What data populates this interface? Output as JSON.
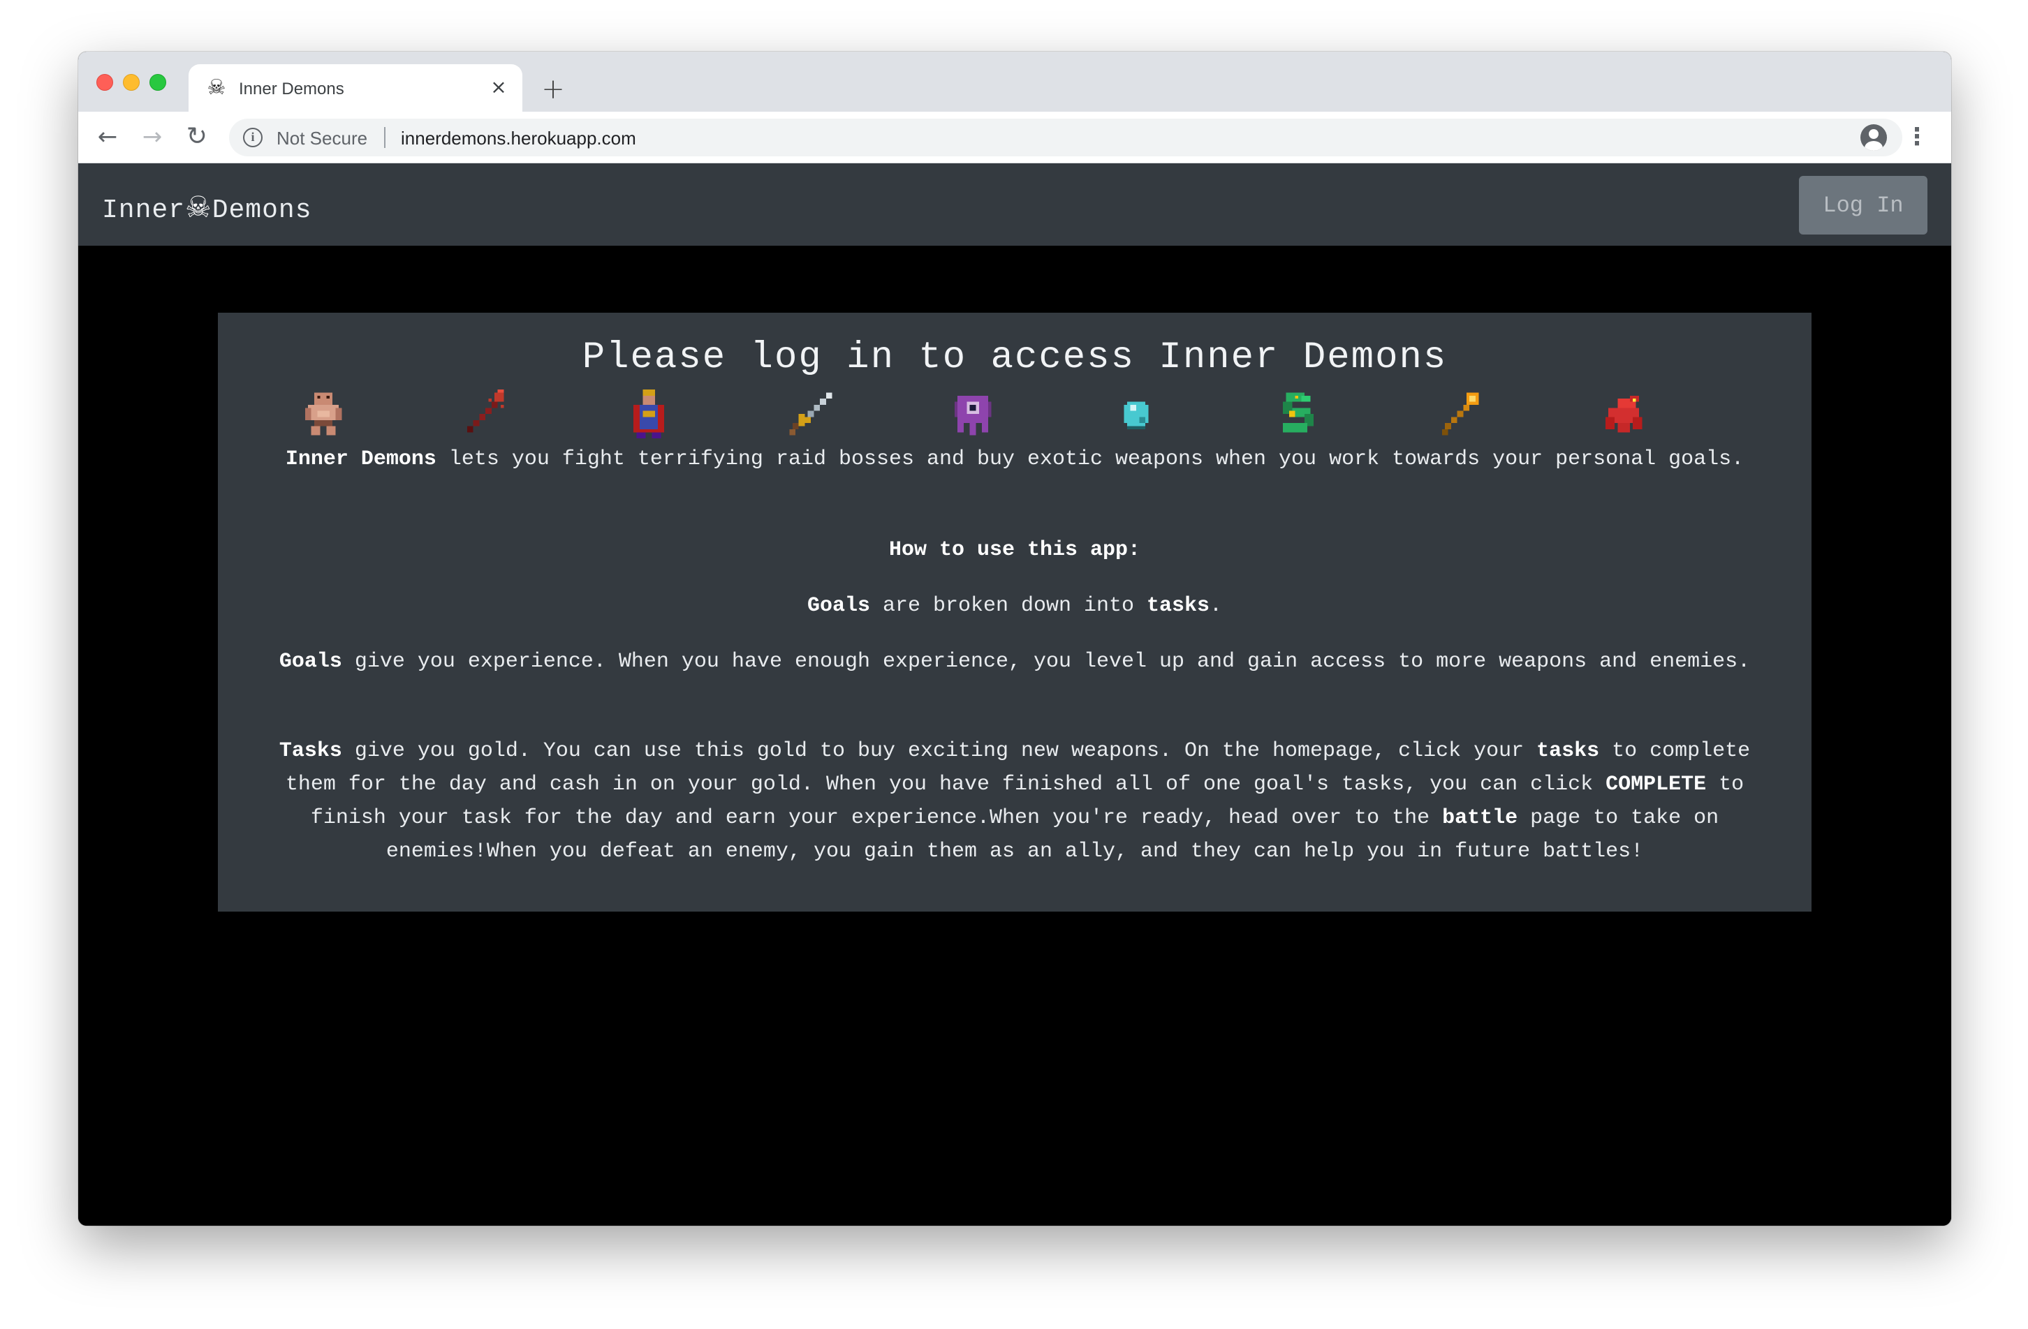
{
  "browser": {
    "tab_title": "Inner Demons",
    "tab_favicon": "skull-icon",
    "security_label": "Not Secure",
    "url": "innerdemons.herokuapp.com"
  },
  "navbar": {
    "brand_left": "Inner",
    "brand_right": "Demons",
    "brand_icon": "skull-crossbones-icon",
    "login_label": "Log In"
  },
  "card": {
    "heading": "Please log in to access Inner Demons",
    "sprites": [
      "ogre-sprite",
      "red-spear-sprite",
      "demon-king-sprite",
      "sword-sprite",
      "purple-tentacle-sprite",
      "crystal-orb-sprite",
      "green-serpent-sprite",
      "golden-staff-sprite",
      "red-dragon-sprite"
    ],
    "intro": {
      "bold": "Inner Demons",
      "rest": " lets you fight terrifying raid bosses and buy exotic weapons when you work towards your personal goals."
    },
    "howto_title": "How to use this app:",
    "goals_line": {
      "b1": "Goals",
      "t1": " are broken down into ",
      "b2": "tasks",
      "t2": "."
    },
    "goals_exp": {
      "bold": "Goals",
      "rest": " give you experience. When you have enough experience, you level up and gain access to more weapons and enemies."
    },
    "tasks_para": {
      "b1": "Tasks",
      "t1": " give you gold. You can use this gold to buy exciting new weapons. On the homepage, click your ",
      "b2": "tasks",
      "t2": " to complete them for the day and cash in on your gold. When you have finished all of one goal's tasks, you can click ",
      "b3": "COMPLETE",
      "t3": " to finish your task for the day and earn your experience.When you're ready, head over to the ",
      "b4": "battle",
      "t4": " page to take on enemies!When you defeat an enemy, you gain them as an ally, and they can help you in future battles!"
    }
  },
  "colors": {
    "navbar_bg": "#343a40",
    "card_bg": "#343a40",
    "page_bg": "#000000",
    "button_bg": "#6c757d"
  }
}
